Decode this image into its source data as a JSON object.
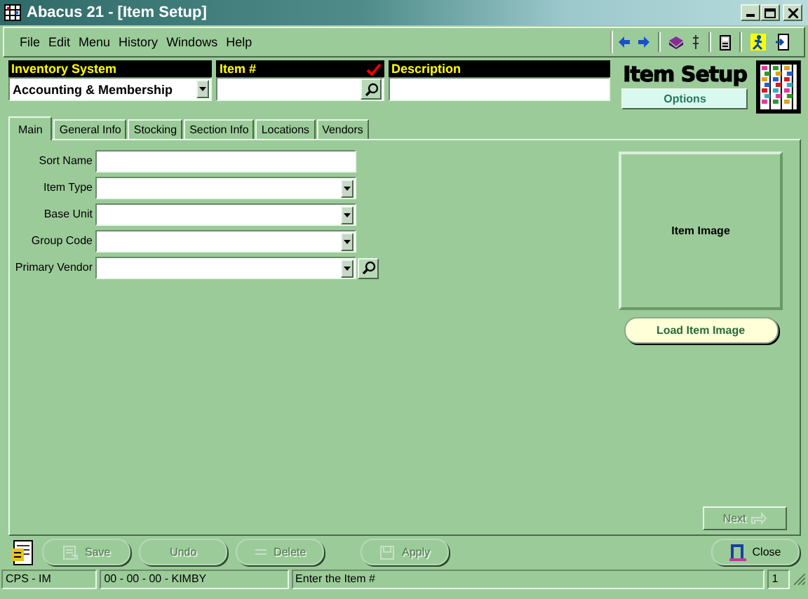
{
  "window": {
    "title": "Abacus 21 - [Item Setup]"
  },
  "menu": [
    "File",
    "Edit",
    "Menu",
    "History",
    "Windows",
    "Help"
  ],
  "header": {
    "fields": [
      {
        "label": "Inventory System",
        "value": "Accounting & Membership",
        "kind": "dropdown",
        "required": false
      },
      {
        "label": "Item #",
        "kind": "lookup",
        "required": true
      },
      {
        "label": "Description",
        "kind": "text",
        "required": false
      }
    ],
    "title": "Item Setup",
    "options_button": "Options"
  },
  "tabs": [
    {
      "label": "Main",
      "selected": true
    },
    {
      "label": "General Info",
      "selected": false
    },
    {
      "label": "Stocking",
      "selected": false
    },
    {
      "label": "Section Info",
      "selected": false
    },
    {
      "label": "Locations",
      "selected": false
    },
    {
      "label": "Vendors",
      "selected": false
    }
  ],
  "form": [
    {
      "label": "Sort Name",
      "kind": "text"
    },
    {
      "label": "Item Type",
      "kind": "dropdown"
    },
    {
      "label": "Base Unit",
      "kind": "dropdown"
    },
    {
      "label": "Group Code",
      "kind": "dropdown"
    },
    {
      "label": "Primary Vendor",
      "kind": "dropdown-lookup"
    }
  ],
  "image_panel": {
    "label": "Item Image",
    "button": "Load Item Image"
  },
  "next_button": {
    "label": "Next",
    "disabled": true
  },
  "footer_buttons": [
    {
      "label": "Save",
      "kind": "save",
      "disabled": true
    },
    {
      "label": "Undo",
      "kind": "undo",
      "disabled": true
    },
    {
      "label": "Delete",
      "kind": "delete",
      "disabled": true
    },
    {
      "label": "Apply",
      "kind": "apply",
      "disabled": true
    },
    {
      "label": "Close",
      "kind": "close",
      "disabled": false
    }
  ],
  "status_bar": [
    "CPS - IM",
    "00 - 00 - 00 - KIMBY",
    "Enter the Item #",
    "1"
  ]
}
